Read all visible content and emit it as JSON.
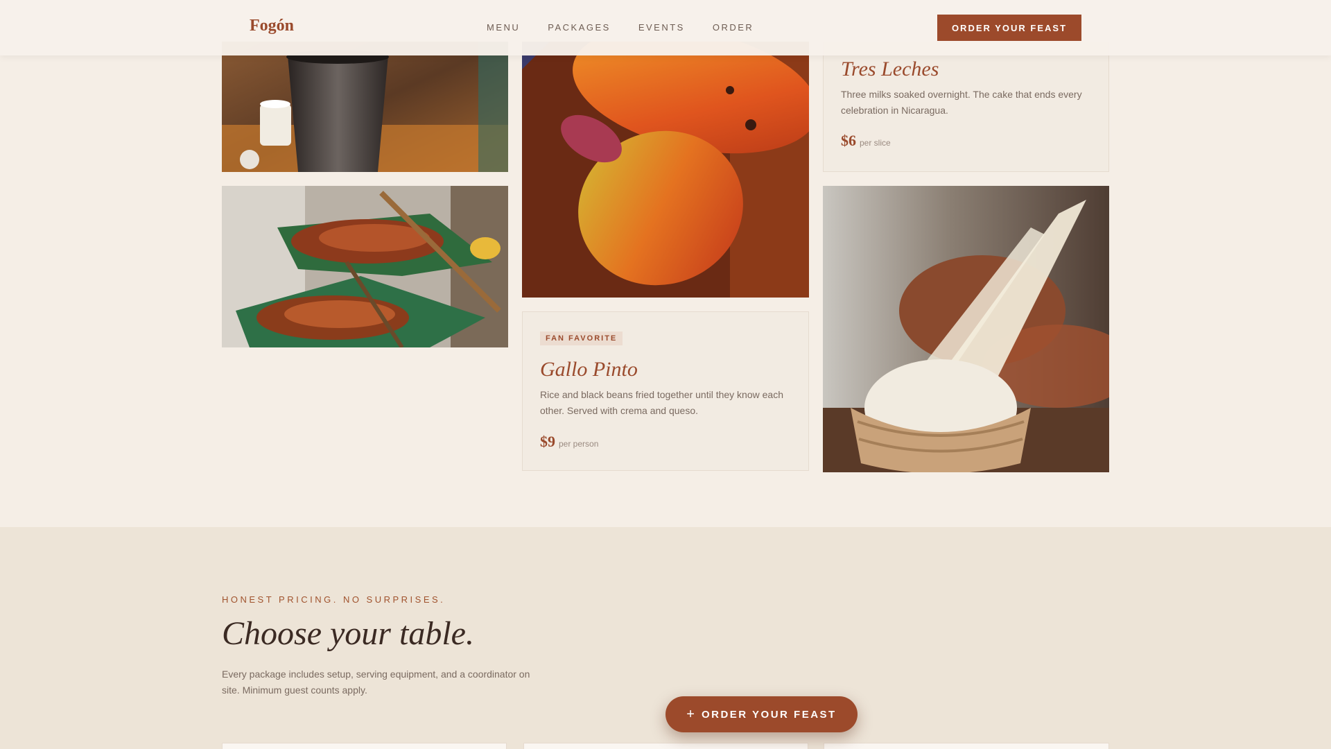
{
  "brand": {
    "logo": "Fogón"
  },
  "nav": {
    "items": [
      {
        "label": "MENU"
      },
      {
        "label": "PACKAGES"
      },
      {
        "label": "EVENTS"
      },
      {
        "label": "ORDER"
      }
    ],
    "cta_label": "ORDER YOUR FEAST"
  },
  "cards": {
    "tres_leches": {
      "title": "Tres Leches",
      "description": "Three milks soaked overnight. The cake that ends every celebration in Nicaragua.",
      "price": "$6",
      "unit": "per slice"
    },
    "gallo_pinto": {
      "badge": "FAN FAVORITE",
      "title": "Gallo Pinto",
      "description": "Rice and black beans fried together until they know each other. Served with crema and queso.",
      "price": "$9",
      "unit": "per person"
    }
  },
  "pricing": {
    "eyebrow": "HONEST PRICING. NO SURPRISES.",
    "title": "Choose your table.",
    "subtitle": "Every package includes setup, serving equipment, and a coordinator on site. Minimum guest counts apply."
  },
  "floating_cta": {
    "icon": "plus-icon",
    "label": "ORDER YOUR FEAST"
  },
  "colors": {
    "accent": "#9c4a2b",
    "background": "#f5eee6",
    "section_background": "#ede4d7",
    "card_background": "#f2ebe2"
  }
}
